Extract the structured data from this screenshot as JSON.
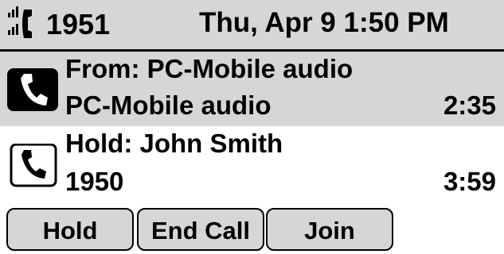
{
  "status_bar": {
    "line_icon": "line-registered-icon",
    "line_number": "1951",
    "datetime": "Thu, Apr 9 1:50 PM"
  },
  "calls": [
    {
      "state": "active",
      "icon": "active-call-icon",
      "line1": "From: PC-Mobile audio",
      "line2": "PC-Mobile audio",
      "timer": "2:35"
    },
    {
      "state": "held",
      "icon": "held-call-icon",
      "line1": "Hold: John Smith",
      "line2": "1950",
      "timer": "3:59"
    }
  ],
  "softkeys": {
    "hold": "Hold",
    "end_call": "End Call",
    "join": "Join"
  },
  "colors": {
    "highlight": "#d6d6d6",
    "background": "#ffffff",
    "foreground": "#000000"
  }
}
